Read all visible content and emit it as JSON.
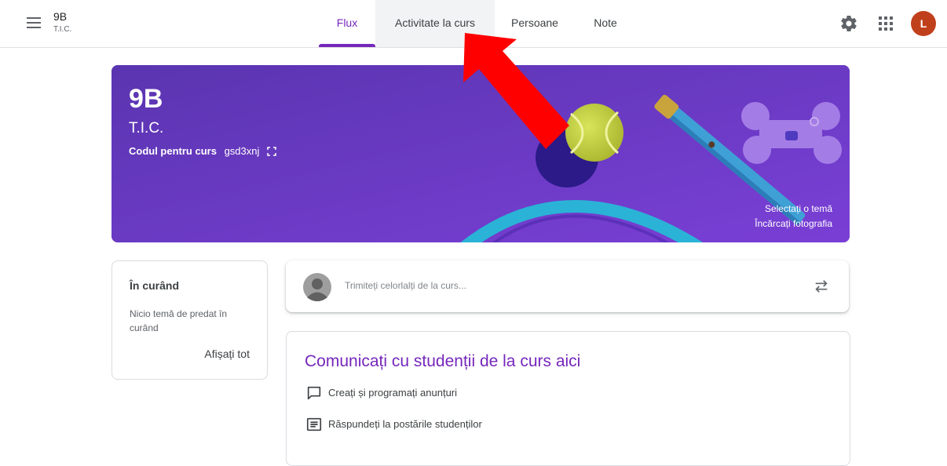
{
  "header": {
    "class_name": "9B",
    "class_section": "T.I.C.",
    "tabs": [
      {
        "label": "Flux",
        "active": true
      },
      {
        "label": "Activitate la curs",
        "active": false,
        "hovered": true
      },
      {
        "label": "Persoane",
        "active": false
      },
      {
        "label": "Note",
        "active": false
      }
    ],
    "icons": [
      "menu-icon",
      "settings-icon",
      "apps-icon"
    ],
    "avatar_letter": "L"
  },
  "banner": {
    "title": "9B",
    "subtitle": "T.I.C.",
    "code_label": "Codul pentru curs",
    "code_value": "gsd3xnj",
    "select_theme": "Selectați o temă",
    "upload_photo": "Încărcați fotografia"
  },
  "upcoming": {
    "title": "În curând",
    "empty_text": "Nicio temă de predat în curând",
    "view_all": "Afișați tot"
  },
  "share": {
    "placeholder": "Trimiteți celorlalți de la curs..."
  },
  "communicate": {
    "title": "Comunicați cu studenții de la curs aici",
    "items": [
      {
        "icon": "announcement-icon",
        "text": "Creați și programați anunțuri"
      },
      {
        "icon": "comment-icon",
        "text": "Răspundeți la postările studenților"
      }
    ]
  },
  "colors": {
    "accent": "#7627bb",
    "banner": "#5a36b2",
    "avatar": "#c0401b",
    "arrow": "#ff0000"
  }
}
